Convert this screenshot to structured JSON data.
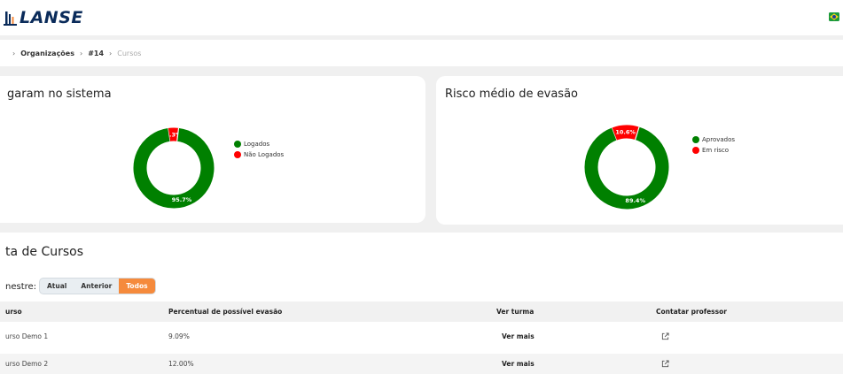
{
  "app": {
    "logo_text": "LANSE",
    "flag": "brazil-flag-icon"
  },
  "breadcrumb": [
    "Organizações",
    "#14",
    "Cursos"
  ],
  "cards": {
    "logged": {
      "title": "garam no sistema",
      "legend": [
        "Logados",
        "Não Logados"
      ],
      "values": [
        95.7,
        4.3
      ],
      "labels": [
        "95.7%",
        "4.3%"
      ]
    },
    "risk": {
      "title": "Risco médio de evasão",
      "legend": [
        "Aprovados",
        "Em risco"
      ],
      "values": [
        89.4,
        10.6
      ],
      "labels": [
        "89.4%",
        "10.6%"
      ]
    }
  },
  "colors": {
    "green": "#008000",
    "red": "#ff0000",
    "accent": "#f58a3c"
  },
  "courses": {
    "title": "ta de Cursos",
    "semester_label": "nestre:",
    "semester_options": [
      "Atual",
      "Anterior",
      "Todos"
    ],
    "semester_selected": "Todos",
    "columns": [
      "urso",
      "Percentual de possível evasão",
      "Ver turma",
      "Contatar professor"
    ],
    "rows": [
      {
        "name": "urso Demo 1",
        "percent": "9.09%",
        "link": "Ver mais"
      },
      {
        "name": "urso Demo 2",
        "percent": "12.00%",
        "link": "Ver mais"
      }
    ]
  }
}
